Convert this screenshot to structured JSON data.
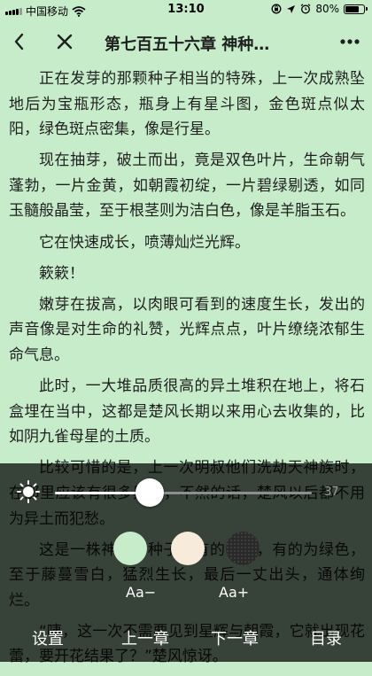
{
  "status_bar": {
    "carrier": "中国移动",
    "time": "13:10",
    "battery_percent": "80%",
    "battery_level": 0.8
  },
  "nav": {
    "title": "第七百五十六章 神种…",
    "icons": [
      "back-arrow-icon",
      "close-icon",
      "more-icon"
    ]
  },
  "content": {
    "paragraphs": [
      "正在发芽的那颗种子相当的特殊，上一次成熟坠地后为宝瓶形态，瓶身上有星斗图，金色斑点似太阳，绿色斑点密集，像是行星。",
      "现在抽芽，破土而出，竟是双色叶片，生命朝气蓬勃，一片金黄，如朝霞初绽，一片碧绿剔透，如同玉髓般晶莹，至于根茎则为洁白色，像是羊脂玉石。",
      "它在快速成长，喷薄灿烂光辉。",
      "簌簌！",
      "嫩芽在拔高，以肉眼可看到的速度生长，发出的声音像是对生命的礼赞，光辉点点，叶片缭绕浓郁生命气息。",
      "此时，一大堆品质很高的异土堆积在地上，将石盒埋在当中，这都是楚风长期以来用心去收集的，比如阴九雀母星的土质。",
      "比较可惜的是，上一次明叔他们洗劫天神族时，在那里应该有很多异土，不然的话，楚风以后都不用为异土而犯愁。",
      "这是一株神奇的种子，有的为红，有的为绿色，至于藤蔓雪白，猛烈生长，最后一丈出头，通体绚烂。",
      "“咦，这一次不需要见到星辉与朝霞，它就出现花蕾，要开花结果了？”楚风惊讶。"
    ]
  },
  "settings_panel": {
    "brightness_value": "37",
    "brightness_level": 0.37,
    "theme_colors": [
      "#c7ecca",
      "#f6ecd9",
      "#2a2a2a"
    ],
    "font_small_label": "Aa−",
    "font_large_label": "Aa+"
  },
  "bottom_bar": {
    "settings_label": "设置",
    "prev_label": "上一章",
    "next_label": "下一章",
    "toc_label": "目录"
  }
}
